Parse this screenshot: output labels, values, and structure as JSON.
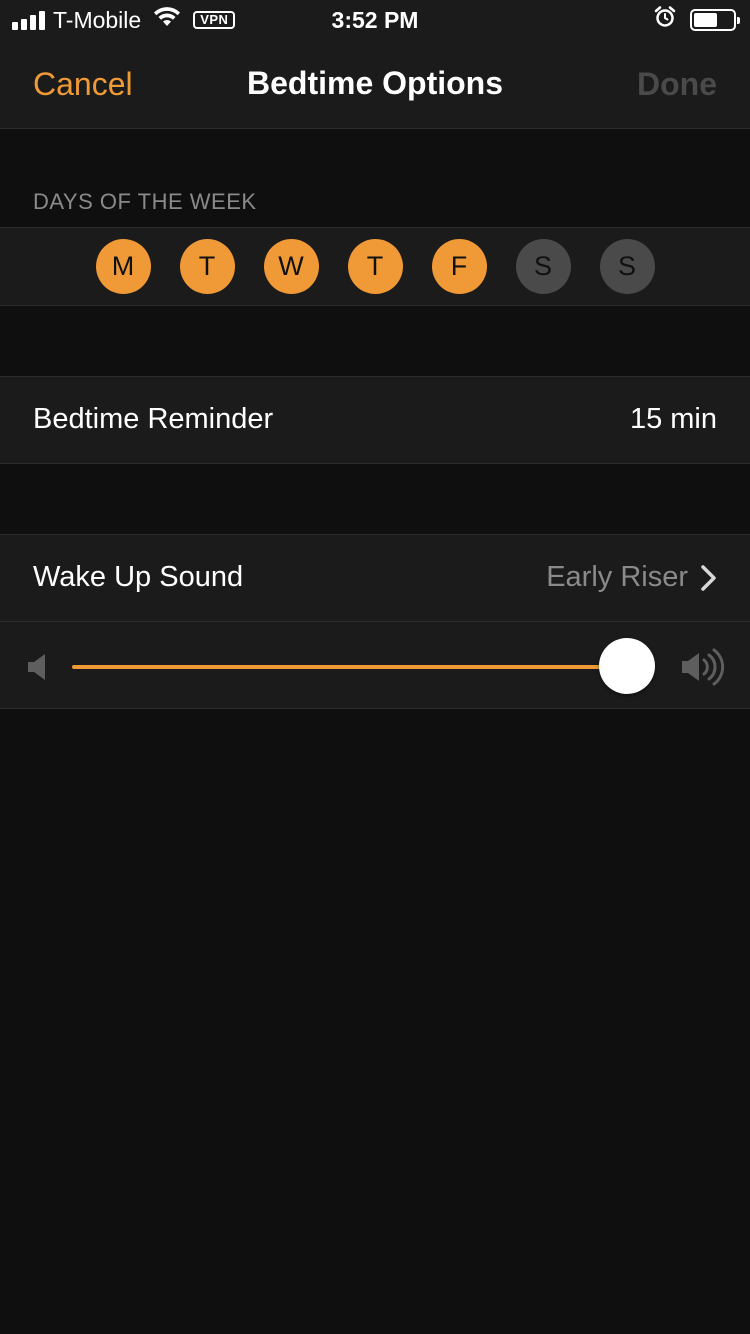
{
  "status_bar": {
    "carrier": "T-Mobile",
    "vpn": "VPN",
    "time": "3:52 PM"
  },
  "nav": {
    "cancel": "Cancel",
    "title": "Bedtime Options",
    "done": "Done"
  },
  "days_section": {
    "label": "DAYS OF THE WEEK",
    "days": [
      {
        "letter": "M",
        "selected": true
      },
      {
        "letter": "T",
        "selected": true
      },
      {
        "letter": "W",
        "selected": true
      },
      {
        "letter": "T",
        "selected": true
      },
      {
        "letter": "F",
        "selected": true
      },
      {
        "letter": "S",
        "selected": false
      },
      {
        "letter": "S",
        "selected": false
      }
    ]
  },
  "reminder": {
    "label": "Bedtime Reminder",
    "value": "15 min"
  },
  "wake_sound": {
    "label": "Wake Up Sound",
    "value": "Early Riser",
    "volume_fraction": 1.0
  },
  "colors": {
    "accent": "#f09a37",
    "background": "#0f0f0f",
    "cell": "#1b1b1b",
    "muted_text": "#8a8a8a",
    "disabled_day": "#4a4a4a"
  }
}
